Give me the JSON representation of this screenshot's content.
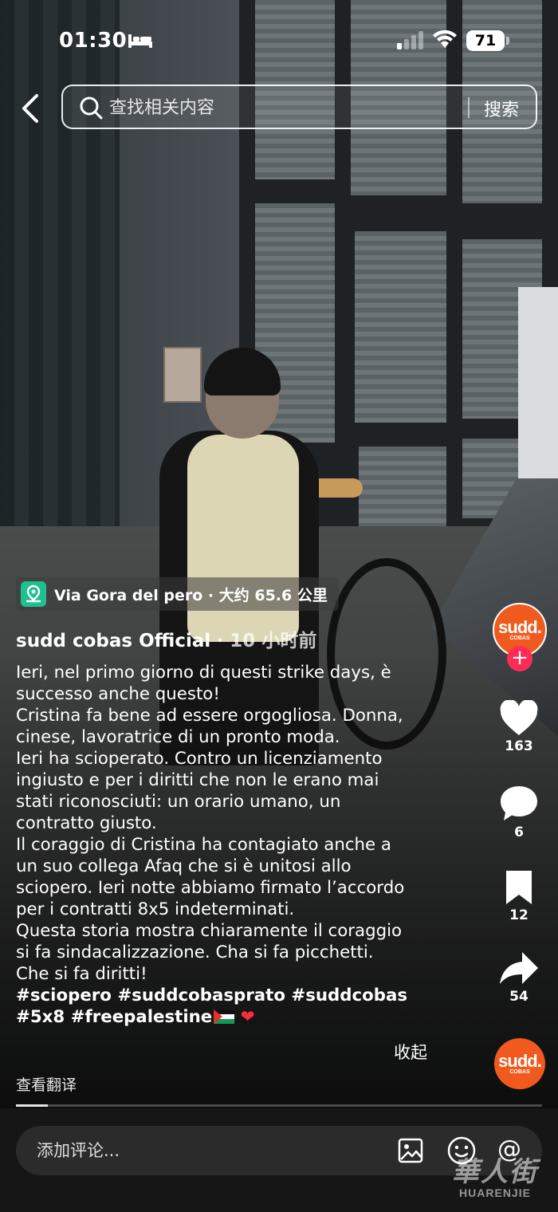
{
  "status_bar": {
    "time": "01:30",
    "battery": "71",
    "icons": [
      "bed-icon",
      "signal-icon",
      "wifi-icon",
      "battery-icon"
    ]
  },
  "search": {
    "placeholder": "查找相关内容",
    "button_label": "搜索"
  },
  "location": {
    "text": "Via Gora del pero · 大约 65.6 公里",
    "icon": "map-pin-icon",
    "accent_color": "#1fbf8f"
  },
  "post": {
    "author": "sudd cobas Official",
    "time_ago": "· 10 小时前",
    "caption_lines": [
      "Ieri, nel primo giorno di questi strike days, è",
      "successo anche questo!",
      "Cristina fa bene ad essere orgogliosa. Donna,",
      "cinese, lavoratrice di un pronto moda.",
      "Ieri ha scioperato. Contro un licenziamento",
      "ingiusto e per i diritti che non le erano mai",
      "stati riconosciuti: un orario umano, un",
      "contratto giusto.",
      "Il coraggio di Cristina ha contagiato anche a",
      "un suo collega Afaq che si è unitosi allo",
      "sciopero. Ieri notte abbiamo firmato l’accordo",
      "per i contratti 8x5 indeterminati.",
      "Questa storia mostra chiaramente il coraggio",
      "si fa sindacalizzazione. Cha si fa picchetti.",
      "Che si fa diritti!"
    ],
    "hashtags_line1": "#sciopero #suddcobasprato #suddcobas",
    "hashtags_line2": "#5x8 #freepalestine",
    "collapse_label": "收起",
    "translate_label": "查看翻译",
    "progress": 0.06
  },
  "actions": {
    "avatar_logo": "sudd.",
    "avatar_sub": "COBAS",
    "follow_label": "+",
    "likes": "163",
    "comments": "6",
    "saves": "12",
    "shares": "54",
    "brand_color": "#f05a1e",
    "follow_color": "#fe2c55"
  },
  "comment_bar": {
    "placeholder": "添加评论...",
    "mention_label": "@"
  },
  "watermark": {
    "cn": "華人街",
    "en": "HUARENJIE"
  }
}
